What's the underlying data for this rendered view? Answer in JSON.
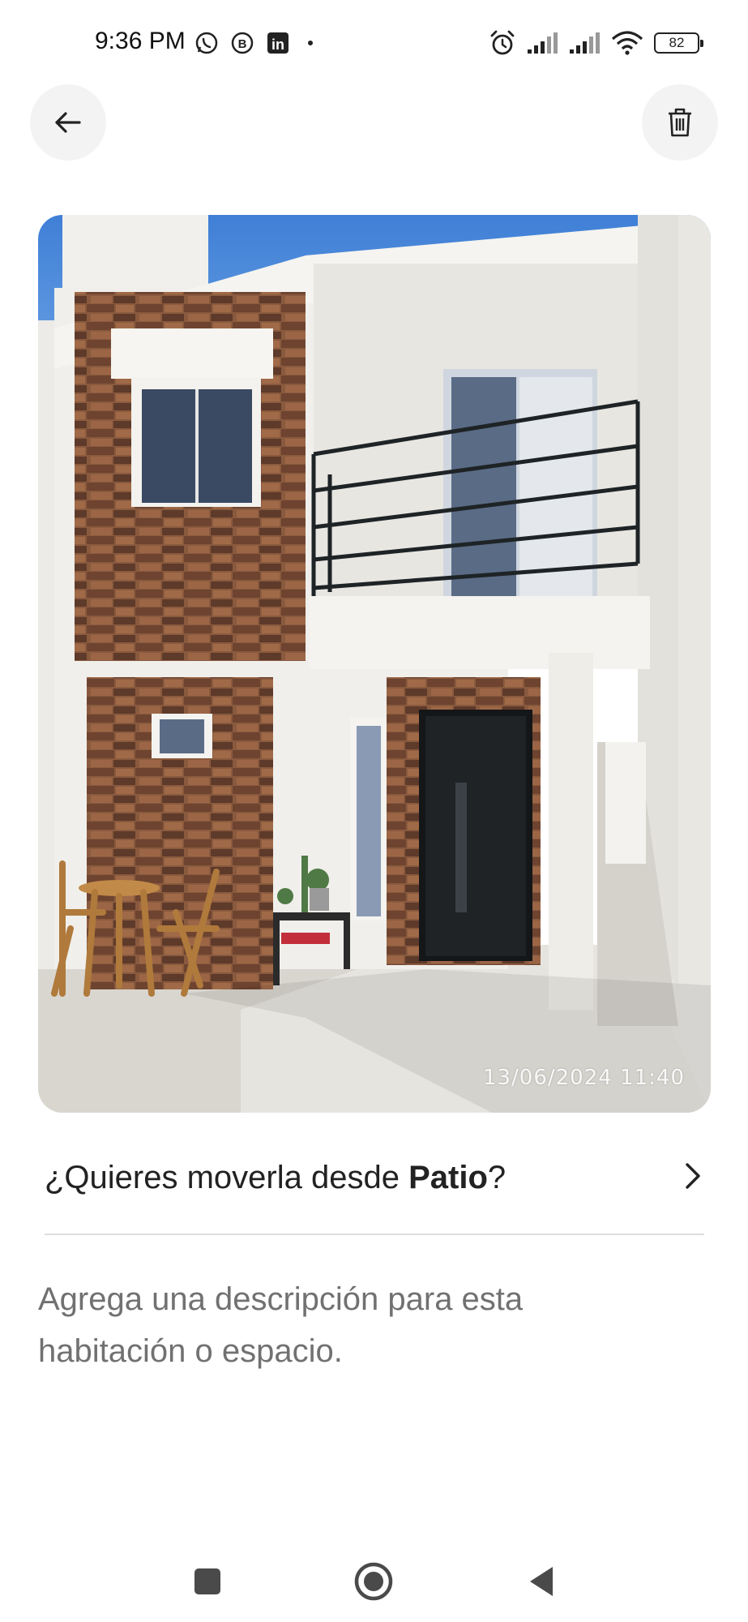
{
  "status_bar": {
    "time": "9:36 PM",
    "left_icons": [
      "whatsapp-icon",
      "b-app-icon",
      "linkedin-icon",
      "dot-icon"
    ],
    "right_icons": [
      "alarm-icon",
      "signal-icon",
      "signal-icon",
      "wifi-icon",
      "battery-icon"
    ],
    "battery": "82"
  },
  "header": {
    "back_icon": "arrow-left-icon",
    "delete_icon": "trash-icon"
  },
  "photo": {
    "timestamp": "13/06/2024  11:40"
  },
  "move_prompt": {
    "prefix": "¿Quieres moverla desde ",
    "room": "Patio",
    "suffix": "?",
    "chevron_icon": "chevron-right-icon"
  },
  "description": {
    "placeholder": "Agrega una descripción para esta habitación o espacio."
  },
  "nav": {
    "icons": [
      "square-recents-icon",
      "circle-home-icon",
      "triangle-back-icon"
    ]
  },
  "colors": {
    "background": "#ffffff",
    "button_bg": "#f3f3f3",
    "text": "#222222",
    "placeholder": "#717171",
    "divider": "#dedede"
  }
}
